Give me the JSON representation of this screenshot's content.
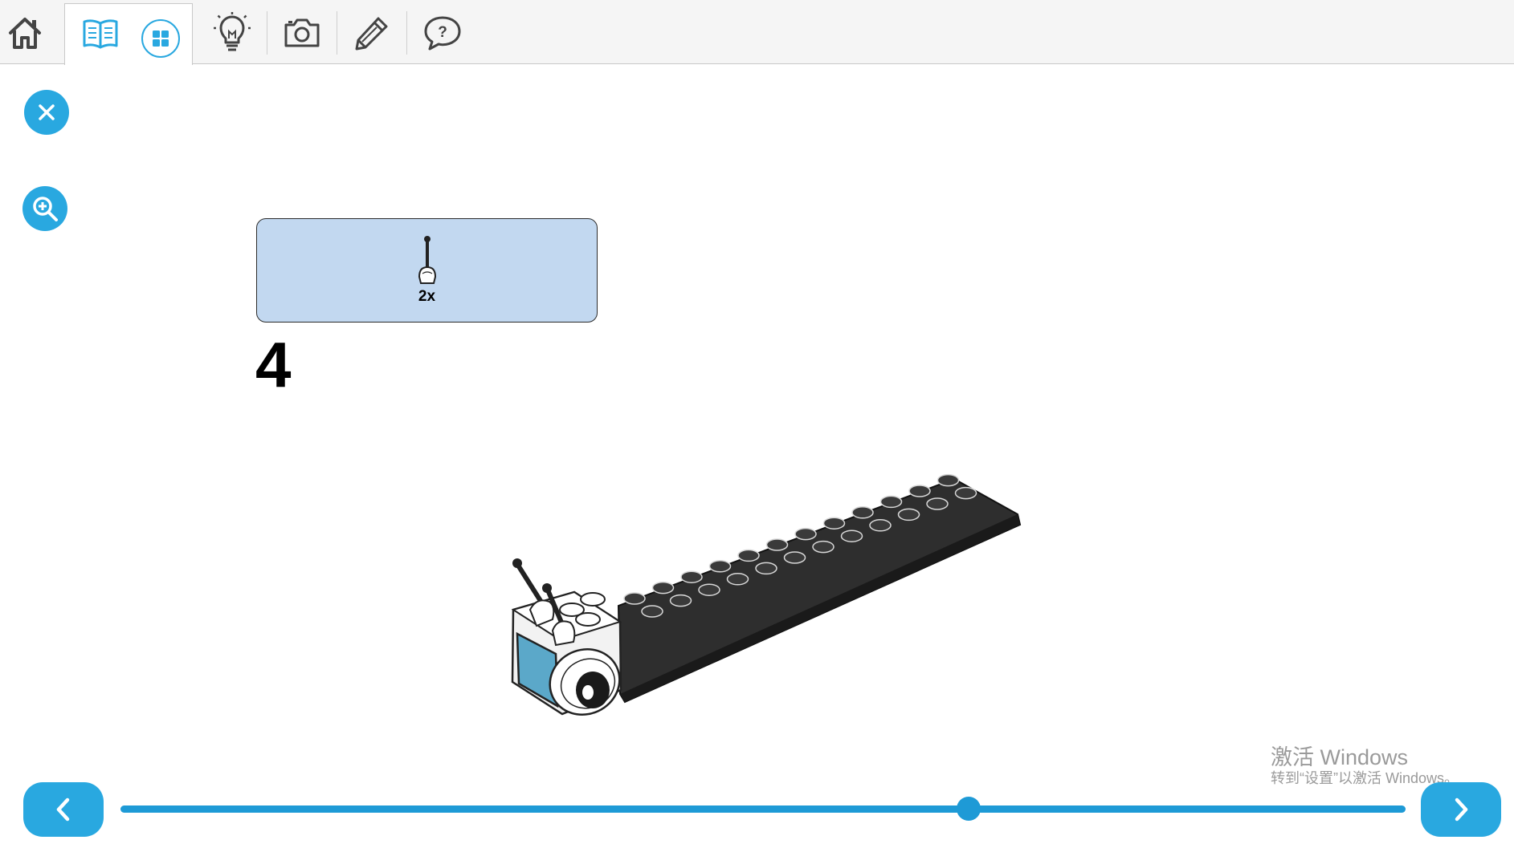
{
  "toolbar": {
    "items": [
      {
        "id": "home",
        "icon": "home-icon"
      },
      {
        "id": "instructions",
        "icon": "book-icon",
        "active": true
      },
      {
        "id": "overview",
        "icon": "grid-icon"
      },
      {
        "id": "ideas",
        "icon": "lightbulb-icon"
      },
      {
        "id": "camera",
        "icon": "camera-icon"
      },
      {
        "id": "notes",
        "icon": "pencil-icon"
      },
      {
        "id": "help",
        "icon": "help-icon"
      }
    ]
  },
  "side_buttons": [
    {
      "id": "close",
      "icon": "close-icon"
    },
    {
      "id": "zoom",
      "icon": "zoom-in-icon"
    }
  ],
  "parts_callout": {
    "quantity": "2x"
  },
  "step": {
    "number": "4"
  },
  "watermark": {
    "line1": "激活 Windows",
    "line2": "转到“设置”以激活 Windows。"
  },
  "navigation": {
    "progress": 0.66
  },
  "colors": {
    "accent": "#29a8e0",
    "callout_bg": "#c2d8f0",
    "brick_dark": "#2e2e2e",
    "screen_blue": "#5ba8c9"
  }
}
